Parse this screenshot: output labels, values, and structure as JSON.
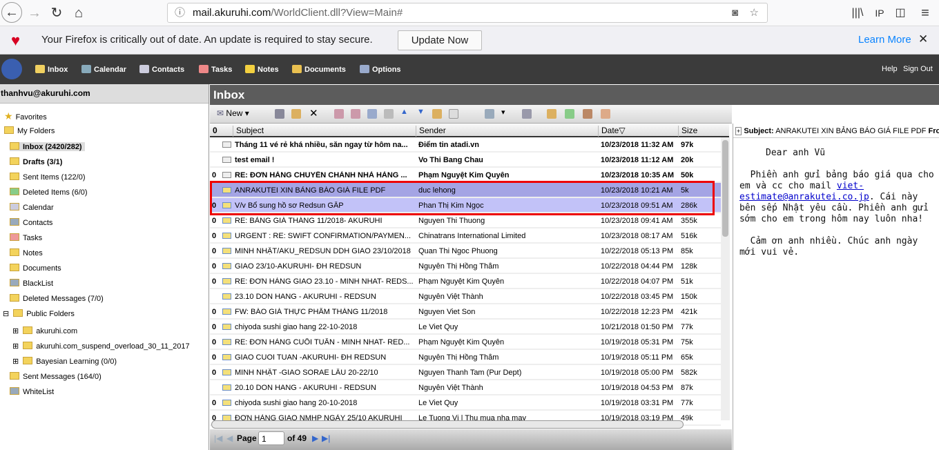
{
  "browser": {
    "url_host": "mail.akuruhi.com",
    "url_path": "/WorldClient.dll?View=Main#"
  },
  "notice": {
    "text": "Your Firefox is critically out of date. An update is required to stay secure.",
    "update": "Update Now",
    "learn": "Learn More"
  },
  "nav": {
    "items": [
      "Inbox",
      "Calendar",
      "Contacts",
      "Tasks",
      "Notes",
      "Documents",
      "Options"
    ],
    "help": "Help",
    "signout": "Sign Out"
  },
  "sidebar": {
    "user": "thanhvu@akuruhi.com",
    "items": [
      "Favorites",
      "My Folders",
      "Inbox (2420/282)",
      "Drafts (3/1)",
      "Sent Items (122/0)",
      "Deleted Items (6/0)",
      "Calendar",
      "Contacts",
      "Tasks",
      "Notes",
      "Documents",
      "BlackList",
      "Deleted Messages (7/0)",
      "Public Folders",
      "akuruhi.com",
      "akuruhi.com_suspend_overload_30_11_2017",
      "Bayesian Learning (0/0)",
      "Sent Messages (164/0)",
      "WhiteList"
    ]
  },
  "inbox": {
    "title": "Inbox",
    "new": "New",
    "columns": {
      "subject": "Subject",
      "sender": "Sender",
      "date": "Date",
      "size": "Size"
    },
    "rows": [
      {
        "s": "Tháng 11 vé rẻ khá nhiều, săn ngay từ hôm na...",
        "f": "Điểm tin atadi.vn",
        "d": "10/23/2018 11:32 AM",
        "z": "97k",
        "a": false,
        "u": true
      },
      {
        "s": "test email !",
        "f": "Vo Thi Bang Chau",
        "d": "10/23/2018 11:12 AM",
        "z": "20k",
        "a": false,
        "u": true
      },
      {
        "s": "RE: ĐƠN HÀNG CHUYỂN CHÀNH NHÀ HÀNG ...",
        "f": "Phạm Nguyệt Kim Quyên",
        "d": "10/23/2018 10:35 AM",
        "z": "50k",
        "a": true,
        "u": true
      },
      {
        "s": "ANRAKUTEI XIN BẢNG BÁO GIÁ FILE PDF",
        "f": "duc lehong",
        "d": "10/23/2018 10:21 AM",
        "z": "5k",
        "a": false,
        "u": false
      },
      {
        "s": "V/v Bổ sung hồ sơ Redsun GẤP",
        "f": "Phan Thị Kim Ngọc",
        "d": "10/23/2018 09:51 AM",
        "z": "286k",
        "a": true,
        "u": false
      },
      {
        "s": "RE: BẢNG GIÁ THÁNG 11/2018- AKURUHI",
        "f": "Nguyen Thi Thuong",
        "d": "10/23/2018 09:41 AM",
        "z": "355k",
        "a": true,
        "u": false
      },
      {
        "s": "URGENT : RE: SWIFT CONFIRMATION/PAYMEN...",
        "f": "Chinatrans International Limited",
        "d": "10/23/2018 08:17 AM",
        "z": "516k",
        "a": true,
        "u": false
      },
      {
        "s": "MINH NHẬT/AKU_REDSUN DDH GIAO 23/10/2018",
        "f": "Quan Thi Ngoc Phuong",
        "d": "10/22/2018 05:13 PM",
        "z": "85k",
        "a": true,
        "u": false
      },
      {
        "s": "GIAO 23/10-AKURUHI- ĐH REDSUN",
        "f": "Nguyễn Thị Hồng Thắm",
        "d": "10/22/2018 04:44 PM",
        "z": "128k",
        "a": true,
        "u": false
      },
      {
        "s": "RE: ĐƠN HÀNG GIAO 23.10 - MINH NHAT- REDS...",
        "f": "Phạm Nguyệt Kim Quyên",
        "d": "10/22/2018 04:07 PM",
        "z": "51k",
        "a": true,
        "u": false
      },
      {
        "s": "23.10 DON HANG - AKURUHI - REDSUN",
        "f": "Nguyễn Việt Thành",
        "d": "10/22/2018 03:45 PM",
        "z": "150k",
        "a": false,
        "u": false
      },
      {
        "s": "FW: BÁO GIÁ THỰC PHẨM THÁNG 11/2018",
        "f": "Nguyen Viet Son",
        "d": "10/22/2018 12:23 PM",
        "z": "421k",
        "a": true,
        "u": false
      },
      {
        "s": "chiyoda sushi giao hang 22-10-2018",
        "f": "Le Viet Quy",
        "d": "10/21/2018 01:50 PM",
        "z": "77k",
        "a": true,
        "u": false
      },
      {
        "s": "RE: ĐƠN HÀNG CUỐI TUẦN - MINH NHAT- RED...",
        "f": "Phạm Nguyệt Kim Quyên",
        "d": "10/19/2018 05:31 PM",
        "z": "75k",
        "a": true,
        "u": false
      },
      {
        "s": "GIAO CUOI TUAN -AKURUHI- ĐH REDSUN",
        "f": "Nguyễn Thị Hồng Thắm",
        "d": "10/19/2018 05:11 PM",
        "z": "65k",
        "a": true,
        "u": false
      },
      {
        "s": "MINH NHẬT -GIAO SORAE LẨU 20-22/10",
        "f": "Nguyen Thanh Tam (Pur Dept)",
        "d": "10/19/2018 05:00 PM",
        "z": "582k",
        "a": true,
        "u": false
      },
      {
        "s": "20.10 DON HANG - AKURUHI - REDSUN",
        "f": "Nguyễn Việt Thành",
        "d": "10/19/2018 04:53 PM",
        "z": "87k",
        "a": false,
        "u": false
      },
      {
        "s": "chiyoda sushi giao hang 20-10-2018",
        "f": "Le Viet Quy",
        "d": "10/19/2018 03:31 PM",
        "z": "77k",
        "a": true,
        "u": false
      },
      {
        "s": "ĐƠN HÀNG GIAO NMHP NGÀY 25/10 AKURUHI",
        "f": "Le Tuong Vi | Thu mua nha may",
        "d": "10/19/2018 03:19 PM",
        "z": "49k",
        "a": true,
        "u": false
      }
    ]
  },
  "pager": {
    "page_label": "Page",
    "page": "1",
    "of": "of 49"
  },
  "preview": {
    "subject_label": "Subject:",
    "subject": "ANRAKUTEI XIN BẢNG BÁO GIÁ FILE PDF",
    "from_label": "From",
    "greeting": "Dear anh Vũ",
    "p1a": "Phiền anh gửi bảng báo giá qua cho em và cc cho mail ",
    "link": "viet-estimate@anrakutei.co.jp",
    "p1b": ". Cái này bên sếp Nhật yêu cầu. Phiền anh gửi sớm cho em trong hôm nay luôn nha!",
    "p2": "Cảm ơn anh nhiều. Chúc anh ngày mới vui vẻ."
  }
}
